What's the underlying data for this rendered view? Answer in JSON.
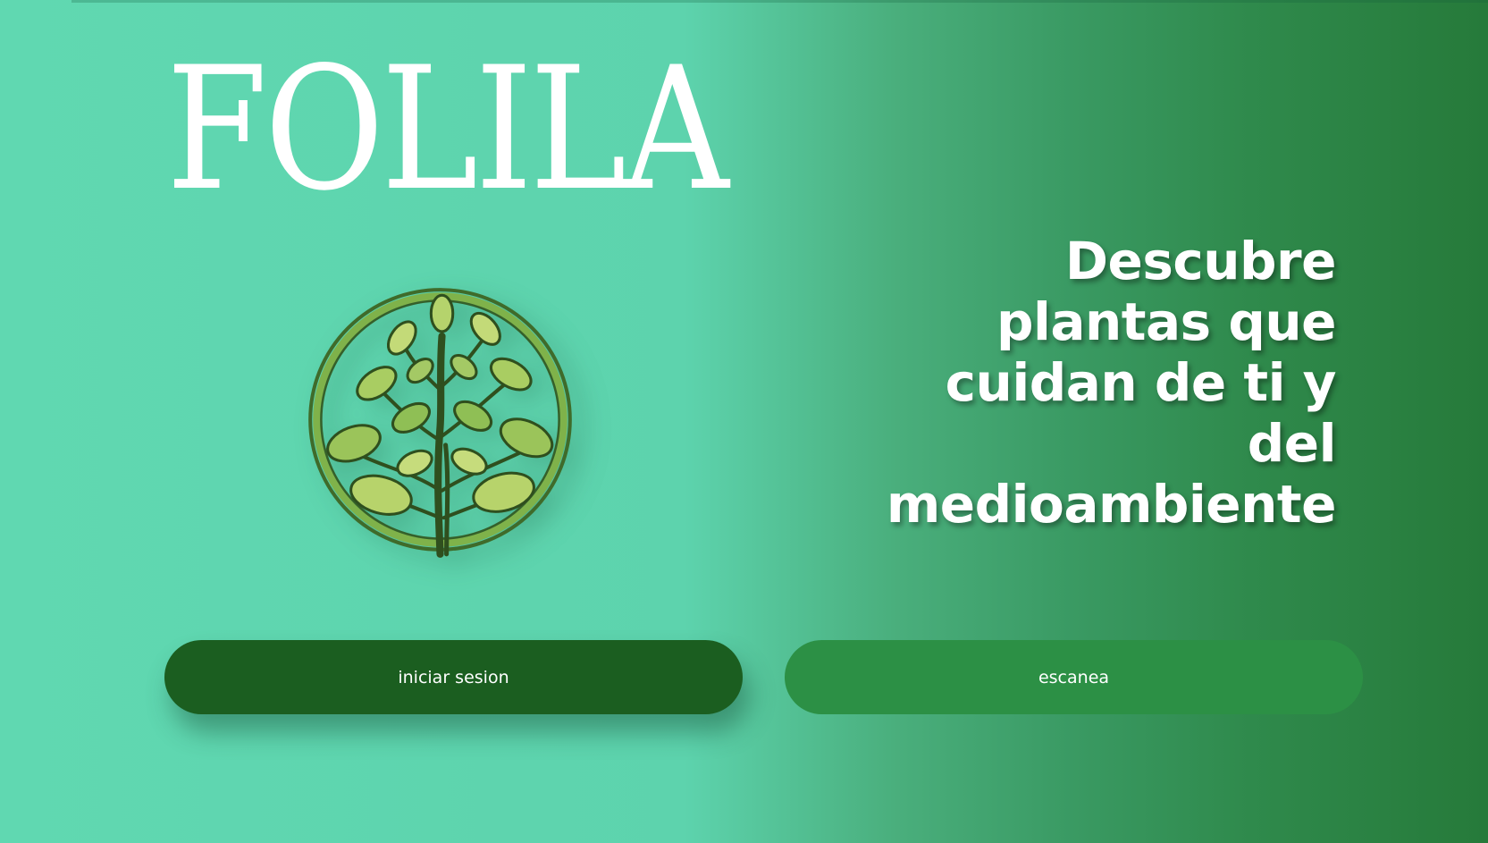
{
  "brand": {
    "name": "FOLILA",
    "logo_icon": "plant-tree-emblem-icon"
  },
  "hero": {
    "tagline_lines": [
      "Descubre",
      "plantas que",
      "cuidan de ti y",
      "del",
      "medioambiente"
    ]
  },
  "actions": {
    "login_label": "iniciar sesion",
    "scan_label": "escanea"
  },
  "colors": {
    "gradient_start": "#60d8b1",
    "gradient_end": "#267a3a",
    "login_button": "#1b5e20",
    "scan_button": "#2c9045",
    "text": "#ffffff"
  }
}
